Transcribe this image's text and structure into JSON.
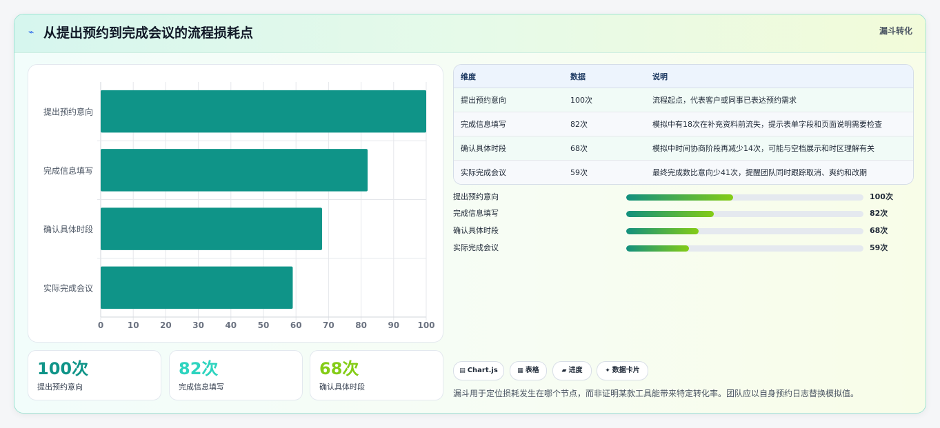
{
  "header": {
    "icon": "lightning-icon",
    "title": "从提出预约到完成会议的流程损耗点",
    "tag": "漏斗转化"
  },
  "chart_data": {
    "type": "bar",
    "orientation": "horizontal",
    "categories": [
      "提出预约意向",
      "完成信息填写",
      "确认具体时段",
      "实际完成会议"
    ],
    "values": [
      100,
      82,
      68,
      59
    ],
    "xlim": [
      0,
      100
    ],
    "xticks": [
      "0",
      "10",
      "20",
      "30",
      "40",
      "50",
      "60",
      "70",
      "80",
      "90",
      "100"
    ],
    "bar_color": "#0f9488",
    "grid": true,
    "legend": "none"
  },
  "kpis": [
    {
      "value": "100次",
      "label": "提出预约意向",
      "color": "#0f9488"
    },
    {
      "value": "82次",
      "label": "完成信息填写",
      "color": "#2dd4bf"
    },
    {
      "value": "68次",
      "label": "确认具体时段",
      "color": "#84cc16"
    }
  ],
  "table": {
    "headers": [
      "维度",
      "数据",
      "说明"
    ],
    "rows": [
      [
        "提出预约意向",
        "100次",
        "流程起点，代表客户或同事已表达预约需求"
      ],
      [
        "完成信息填写",
        "82次",
        "模拟中有18次在补充资料前流失，提示表单字段和页面说明需要检查"
      ],
      [
        "确认具体时段",
        "68次",
        "模拟中时间协商阶段再减少14次，可能与空档展示和时区理解有关"
      ],
      [
        "实际完成会议",
        "59次",
        "最终完成数比意向少41次，提醒团队同时跟踪取消、爽约和改期"
      ]
    ]
  },
  "progress": [
    {
      "label": "提出预约意向",
      "value": "100次",
      "fraction": 0.45
    },
    {
      "label": "完成信息填写",
      "value": "82次",
      "fraction": 0.37
    },
    {
      "label": "确认具体时段",
      "value": "68次",
      "fraction": 0.305
    },
    {
      "label": "实际完成会议",
      "value": "59次",
      "fraction": 0.265
    }
  ],
  "chips": [
    {
      "icon": "chart-icon",
      "glyph": "▤",
      "label": "Chart.js"
    },
    {
      "icon": "table-icon",
      "glyph": "▦",
      "label": "表格"
    },
    {
      "icon": "progress-icon",
      "glyph": "▰",
      "label": "进度"
    },
    {
      "icon": "card-icon",
      "glyph": "✦",
      "label": "数据卡片"
    }
  ],
  "note": "漏斗用于定位损耗发生在哪个节点，而非证明某款工具能带来特定转化率。团队应以自身预约日志替换模拟值。"
}
